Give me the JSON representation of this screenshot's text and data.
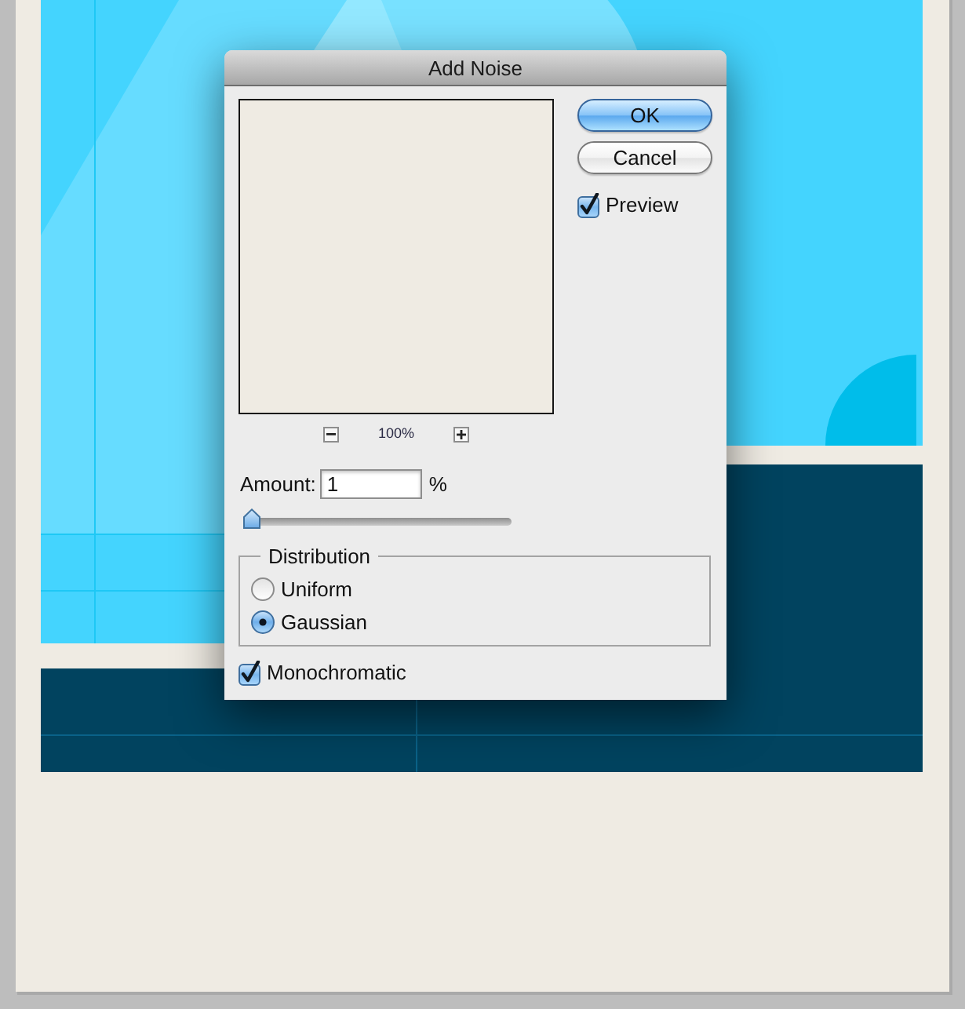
{
  "dialog": {
    "title": "Add Noise",
    "preview_zoom": "100%",
    "buttons": [
      {
        "label": "OK",
        "default": true
      },
      {
        "label": "Cancel",
        "default": false
      }
    ],
    "preview": {
      "label": "Preview",
      "checked": true
    },
    "amount": {
      "label": "Amount:",
      "value": "1",
      "unit": "%",
      "level": 0
    },
    "distribution": {
      "label": "Distribution",
      "options": [
        {
          "label": "Uniform",
          "selected": false
        },
        {
          "label": "Gaussian",
          "selected": true
        }
      ]
    },
    "monochromatic": {
      "label": "Monochromatic",
      "checked": true
    }
  }
}
